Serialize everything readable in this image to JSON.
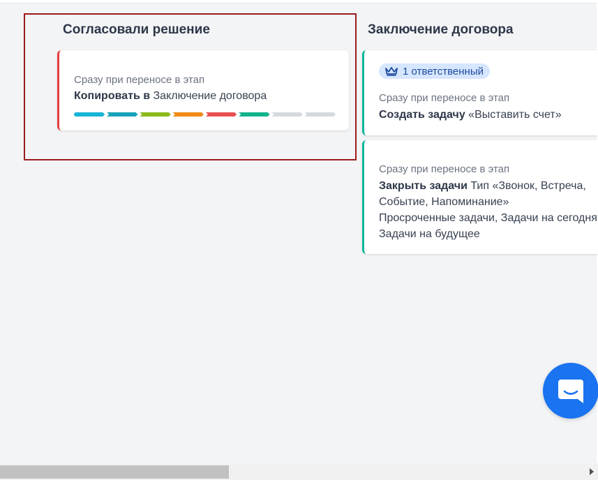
{
  "colors": {
    "background": "#f3f4f6",
    "highlight_border": "#9b1c1c",
    "card_red_accent": "#e53e3e",
    "card_teal_accent": "#0fb59a",
    "badge_bg": "#d6e6ff",
    "badge_text": "#1e4b9e",
    "chat_button": "#1a73f0"
  },
  "columns": [
    {
      "title": "Согласовали решение",
      "cards": [
        {
          "trigger": "Сразу при переносе в этап",
          "action_bold": "Копировать в",
          "action_text": " Заключение договора",
          "progress_colors": [
            "#16b4d6",
            "#16a2b8",
            "#8cb81a",
            "#f08a14",
            "#e85050",
            "#12b28c",
            "#d5d9de",
            "#d5d9de"
          ],
          "progress_completed": 6,
          "progress_total": 8
        }
      ]
    },
    {
      "title": "Заключение договора",
      "cards": [
        {
          "badge": "1 ответственный",
          "badge_icon": "crown-icon",
          "trigger": "Сразу при переносе в этап",
          "action_bold": "Создать задачу",
          "action_text": " «Выставить счет»"
        },
        {
          "trigger": "Сразу при переносе в этап",
          "action_bold": "Закрыть задачи",
          "action_text_1": " Тип «Звонок, Встреча, Событие, Напоминание»",
          "line_2": "Событие, Напоминание»",
          "line_3": "Просроченные задачи, Задачи на сегодня,",
          "line_4": "Задачи на будущее",
          "line_1_visible": " Тип «Звонок, Встреча, "
        }
      ]
    }
  ],
  "chat_button": {
    "icon": "chat-icon"
  },
  "scrollbar": {
    "direction": "horizontal"
  }
}
